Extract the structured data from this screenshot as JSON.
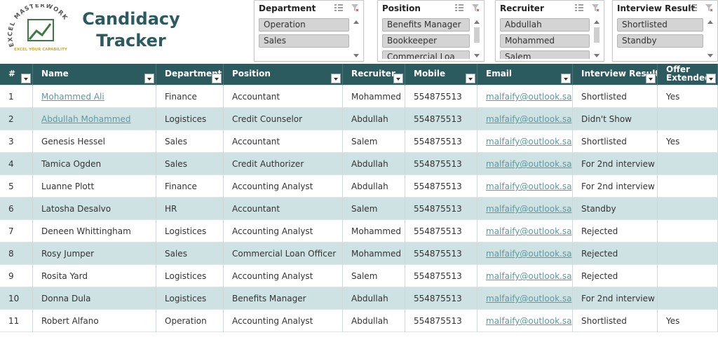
{
  "logo": {
    "brand_text": "EXCEL MASTERWORK",
    "tagline": "EXCEL YOUR CAPABILITY"
  },
  "title": {
    "line1": "Candidacy",
    "line2": "Tracker"
  },
  "slicers": [
    {
      "label": "Department",
      "items": [
        "Operation",
        "Sales"
      ]
    },
    {
      "label": "Position",
      "items": [
        "Benefits Manager",
        "Bookkeeper",
        "Commercial Loa"
      ]
    },
    {
      "label": "Recruiter",
      "items": [
        "Abdullah",
        "Mohammed",
        "Salem"
      ]
    },
    {
      "label": "Interview Result",
      "items": [
        "Shortlisted",
        "Standby"
      ]
    }
  ],
  "table": {
    "headers": [
      "#",
      "Name",
      "Department",
      "Position",
      "Recruiter",
      "Mobile",
      "Email",
      "Interview Result",
      "Offer Extended?"
    ],
    "rows": [
      [
        "1",
        "Mohammed Ali",
        "Finance",
        "Accountant",
        "Mohammed",
        "554875513",
        "malfaify@outlook.sa",
        "Shortlisted",
        "Yes"
      ],
      [
        "2",
        "Abdullah Mohammed",
        "Logistices",
        "Credit Counselor",
        "Abdullah",
        "554875513",
        "malfaify@outlook.sa",
        "Didn't Show",
        ""
      ],
      [
        "3",
        "Genesis Hessel",
        "Sales",
        "Accountant",
        "Salem",
        "554875513",
        "malfaify@outlook.sa",
        "Shortlisted",
        "Yes"
      ],
      [
        "4",
        "Tamica Ogden",
        "Sales",
        "Credit Authorizer",
        "Abdullah",
        "554875513",
        "malfaify@outlook.sa",
        "For 2nd interview",
        ""
      ],
      [
        "5",
        "Luanne Plott",
        "Finance",
        "Accounting Analyst",
        "Abdullah",
        "554875513",
        "malfaify@outlook.sa",
        "For 2nd interview",
        ""
      ],
      [
        "6",
        "Latosha Desalvo",
        "HR",
        "Accountant",
        "Salem",
        "554875513",
        "malfaify@outlook.sa",
        "Standby",
        ""
      ],
      [
        "7",
        "Deneen Whittingham",
        "Logistices",
        "Accounting Analyst",
        "Mohammed",
        "554875513",
        "malfaify@outlook.sa",
        "Rejected",
        ""
      ],
      [
        "8",
        "Rosy Jumper",
        "Sales",
        "Commercial Loan Officer",
        "Mohammed",
        "554875513",
        "malfaify@outlook.sa",
        "Rejected",
        ""
      ],
      [
        "9",
        "Rosita Yard",
        "Logistices",
        "Accounting Analyst",
        "Salem",
        "554875513",
        "malfaify@outlook.sa",
        "Rejected",
        ""
      ],
      [
        "10",
        "Donna Dula",
        "Logistices",
        "Benefits Manager",
        "Abdullah",
        "554875513",
        "malfaify@outlook.sa",
        "For 2nd interview",
        ""
      ],
      [
        "11",
        "Robert Alfano",
        "Operation",
        "Accounting Analyst",
        "Abdullah",
        "554875513",
        "malfaify@outlook.sa",
        "Shortlisted",
        "Yes"
      ]
    ],
    "linked_name_rows": [
      0,
      1
    ]
  },
  "colors": {
    "header_bg": "#2b5a5f",
    "band": "#cfe2e3",
    "link": "#5a9aa0",
    "title": "#2b5a5f",
    "logo_green": "#3d7a3f",
    "logo_gold": "#d4a82a"
  }
}
